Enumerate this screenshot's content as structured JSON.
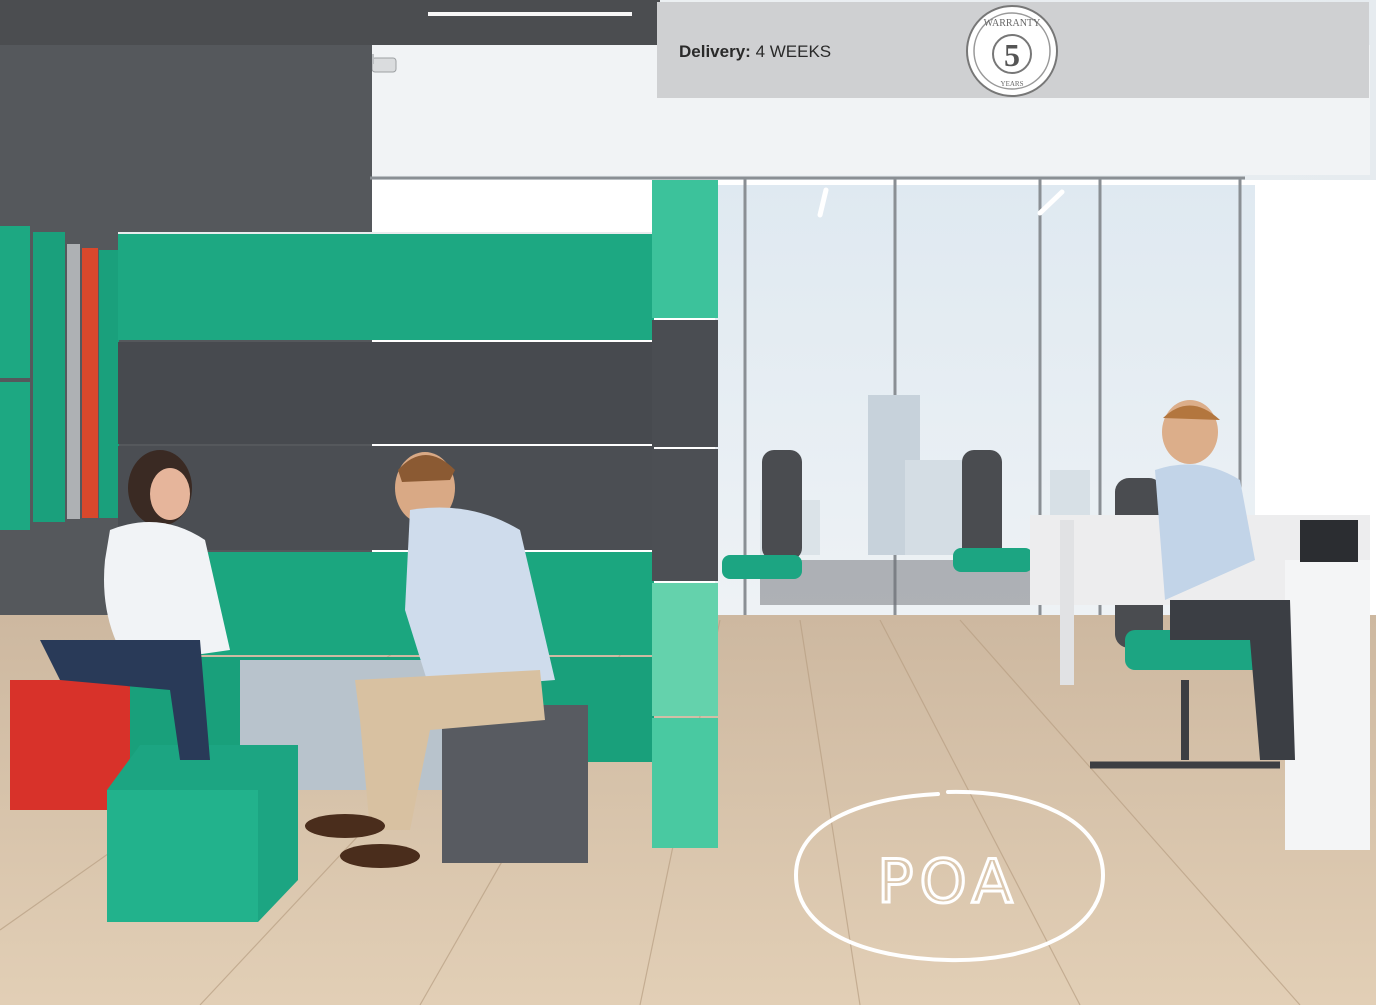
{
  "delivery": {
    "label": "Delivery:",
    "value": "4 WEEKS"
  },
  "warranty_badge": {
    "top_text": "WARRANTY",
    "number": "5",
    "bottom_text": "YEARS"
  },
  "price_stamp": {
    "text": "POA"
  },
  "colors": {
    "felt_green": "#1da882",
    "felt_grey": "#4a4d52",
    "accent_red": "#d9352a",
    "info_bar": "#cfd0d2",
    "floor_wood": "#d8c1a3"
  }
}
